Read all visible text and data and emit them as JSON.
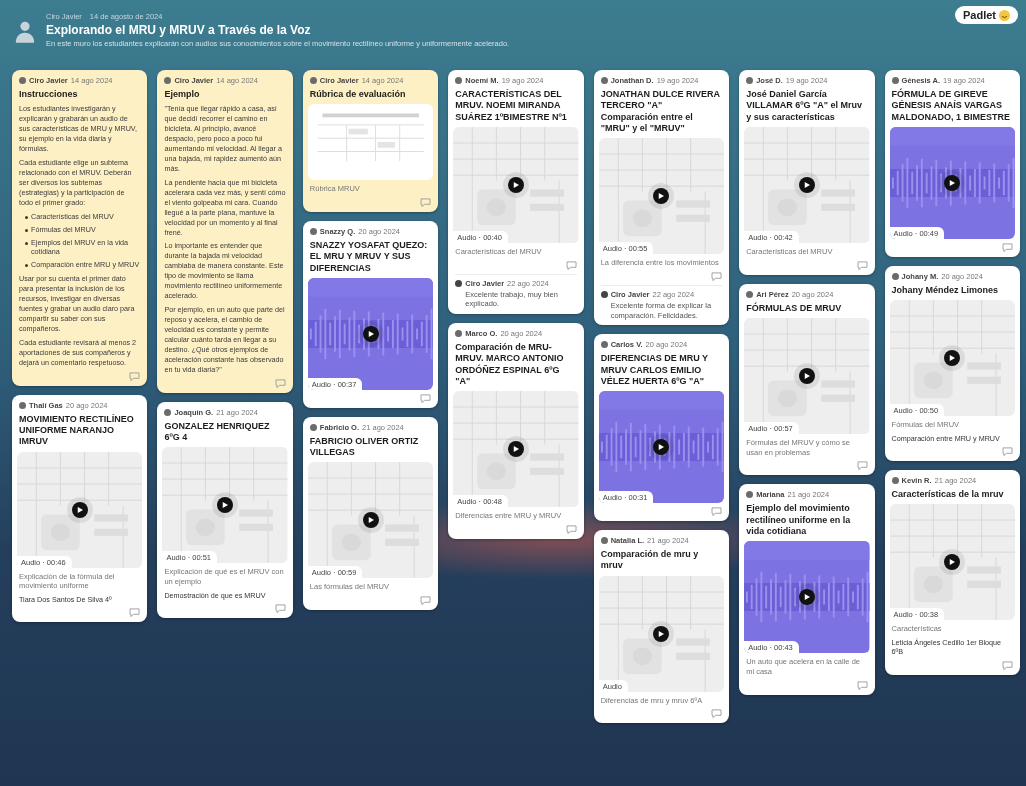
{
  "board": {
    "author": "Ciro Javier",
    "date": "14 de agosto de 2024",
    "title": "Explorando el MRU y MRUV a Través de la Voz",
    "subtitle": "En este muro los estudiantes explicarán con audios sus conocimientos sobre el movimiento rectilíneo uniforme y uniformemente acelerado."
  },
  "logo": {
    "label": "Padlet"
  },
  "columns": [
    {
      "cards": [
        {
          "color": "#fdf0c4",
          "author": "Ciro Javier",
          "date": "14 ago 2024",
          "title": "Instrucciones",
          "body": [
            "Los estudiantes investigarán y explicarán y grabarán un audio de sus características de MRU y MRUV, su ejemplo en la vida diaria y fórmulas.",
            "Cada estudiante elige un subtema relacionado con el MRUV. Deberán ser diversos los subtemas (estrategias) y la participación de todo el primer grado:"
          ],
          "bullets": [
            "Características del MRUV",
            "Fórmulas del MRUV",
            "Ejemplos del MRUV en la vida cotidiana",
            "Comparación entre MRU y MRUV"
          ],
          "body_after": [
            "Usar por su cuenta el primer dato para presentar la inclusión de los recursos, investigar en diversas fuentes y grabar un audio claro para compartir su saber con sus compañeros.",
            "Cada estudiante revisará al menos 2 aportaciones de sus compañeros y dejará un comentario respetuoso."
          ]
        },
        {
          "color": "#ffffff",
          "author": "Thalí Gas",
          "date": "20 ago 2024",
          "title": "MOVIMIENTO RECTILÍNEO UNIFORME NARANJO IMRUV",
          "media": {
            "kind": "thumbnail",
            "duration": "Audio · 00:46"
          },
          "caption": "Explicación de la fórmula del movimiento uniforme",
          "note": "Tiara Dos Santos De Silva 4º"
        }
      ]
    },
    {
      "cards": [
        {
          "color": "#fdf0c4",
          "author": "Ciro Javier",
          "date": "14 ago 2024",
          "title": "Ejemplo",
          "body": [
            "\"Tenía que llegar rápido a casa, así que decidí recorrer el camino en bicicleta. Al principio, avancé despacio, pero poco a poco fui aumentando mi velocidad. Al llegar a una bajada, mi rapidez aumentó aún más.",
            "La pendiente hacía que mi bicicleta acelerara cada vez más, y sentí cómo el viento golpeaba mi cara. Cuando llegué a la parte plana, mantuve la velocidad por un momento y al final frené.",
            "Lo importante es entender que durante la bajada mi velocidad cambiaba de manera constante. Este tipo de movimiento se llama movimiento rectilíneo uniformemente acelerado.",
            "Por ejemplo, en un auto que parte del reposo y acelera, el cambio de velocidad es constante y permite calcular cuánto tarda en llegar a su destino. ¿Qué otros ejemplos de aceleración constante has observado en tu vida diaria?\""
          ]
        },
        {
          "color": "#ffffff",
          "author": "Joaquín G.",
          "date": "21 ago 2024",
          "title": "GONZALEZ HENRIQUEZ 6ºG 4",
          "media": {
            "kind": "thumbnail",
            "duration": "Audio · 00:51"
          },
          "caption": "Explicación de qué es el MRUV con un ejemplo",
          "note": "Demostración de que es MRUV"
        }
      ]
    },
    {
      "cards": [
        {
          "color": "#fdf0c4",
          "author": "Ciro Javier",
          "date": "14 ago 2024",
          "title": "Rúbrica de evaluación",
          "media": {
            "kind": "document"
          },
          "caption": "Rúbrica MRUV"
        },
        {
          "color": "#ffffff",
          "author": "Snazzy Q.",
          "date": "20 ago 2024",
          "title": "SNAZZY YOSAFAT QUEZO: EL MRU Y MRUV Y SUS DIFERENCIAS",
          "media": {
            "kind": "waveform",
            "duration": "Audio · 00:37"
          }
        },
        {
          "color": "#ffffff",
          "author": "Fabricio O.",
          "date": "21 ago 2024",
          "title": "FABRICIO OLIVER ORTIZ VILLEGAS",
          "media": {
            "kind": "thumbnail",
            "duration": "Audio · 00:59"
          },
          "caption": "Las fórmulas del MRUV"
        }
      ]
    },
    {
      "cards": [
        {
          "color": "#ffffff",
          "author": "Noemí M.",
          "date": "19 ago 2024",
          "title": "CARACTERÍSTICAS DEL MRUV. NOEMI MIRANDA SUÁREZ 1ºBIMESTRE Nº1",
          "media": {
            "kind": "thumbnail",
            "duration": "Audio · 00:40"
          },
          "caption": "Características del MRUV",
          "comment": {
            "author": "Ciro Javier",
            "date": "22 ago 2024",
            "text": "Excelente trabajo, muy bien explicado."
          }
        },
        {
          "color": "#ffffff",
          "author": "Marco O.",
          "date": "20 ago 2024",
          "title": "Comparación de MRU-MRUV. MARCO ANTONIO ORDÓÑEZ ESPINAL 6ºG \"A\"",
          "media": {
            "kind": "thumbnail",
            "duration": "Audio · 00:48"
          },
          "caption": "Diferencias entre MRU y MRUV"
        }
      ]
    },
    {
      "cards": [
        {
          "color": "#ffffff",
          "author": "Jonathan D.",
          "date": "19 ago 2024",
          "title": "JONATHAN DULCE RIVERA TERCERO \"A\" Comparación entre el \"MRU\" y el \"MRUV\"",
          "media": {
            "kind": "thumbnail",
            "duration": "Audio · 00:55"
          },
          "caption": "La diferencia entre los movimientos",
          "comment": {
            "author": "Ciro Javier",
            "date": "22 ago 2024",
            "text": "Excelente forma de explicar la comparación. Felicidades."
          }
        },
        {
          "color": "#ffffff",
          "author": "Carlos V.",
          "date": "20 ago 2024",
          "title": "DIFERENCIAS DE MRU Y MRUV CARLOS EMILIO VÉLEZ HUERTA 6ºG \"A\"",
          "media": {
            "kind": "waveform",
            "duration": "Audio · 00:31"
          }
        },
        {
          "color": "#ffffff",
          "author": "Natalia L.",
          "date": "21 ago 2024",
          "title": "Comparación de mru y mruv",
          "media": {
            "kind": "thumbnail",
            "duration": "Audio"
          },
          "caption": "Diferencias de mru y mruv 6ºA"
        }
      ]
    },
    {
      "cards": [
        {
          "color": "#ffffff",
          "author": "José D.",
          "date": "19 ago 2024",
          "title": "José Daniel García VILLAMAR 6ºG \"A\" el Mruv y sus características",
          "media": {
            "kind": "thumbnail",
            "duration": "Audio · 00:42"
          },
          "caption": "Características del MRUV"
        },
        {
          "color": "#ffffff",
          "author": "Ari Pérez",
          "date": "20 ago 2024",
          "title": "FÓRMULAS DE MRUV",
          "media": {
            "kind": "thumbnail",
            "duration": "Audio · 00:57"
          },
          "caption": "Fórmulas del MRUV y cómo se usan en problemas"
        },
        {
          "color": "#ffffff",
          "author": "Mariana",
          "date": "21 ago 2024",
          "title": "Ejemplo del movimiento rectilíneo uniforme en la vida cotidiana",
          "media": {
            "kind": "waveform",
            "duration": "Audio · 00:43"
          },
          "caption": "Un auto que acelera en la calle de mi casa"
        }
      ]
    },
    {
      "cards": [
        {
          "color": "#ffffff",
          "author": "Génesis A.",
          "date": "19 ago 2024",
          "title": "FÓRMULA DE GIREVE GÉNESIS ANAÍS VARGAS MALDONADO, 1 BIMESTRE",
          "media": {
            "kind": "waveform",
            "duration": "Audio · 00:49"
          }
        },
        {
          "color": "#ffffff",
          "author": "Johany M.",
          "date": "20 ago 2024",
          "title": "Johany Méndez Limones",
          "media": {
            "kind": "thumbnail",
            "duration": "Audio · 00:50"
          },
          "caption": "Fórmulas del MRUV",
          "note": "Comparación entre MRU y MRUV"
        },
        {
          "color": "#ffffff",
          "author": "Kevin R.",
          "date": "21 ago 2024",
          "title": "Características de la mruv",
          "media": {
            "kind": "thumbnail",
            "duration": "Audio · 00:38"
          },
          "caption": "Características",
          "note": "Leticia Ángeles Cedillo 1er Bloque 6ºB"
        }
      ]
    }
  ]
}
